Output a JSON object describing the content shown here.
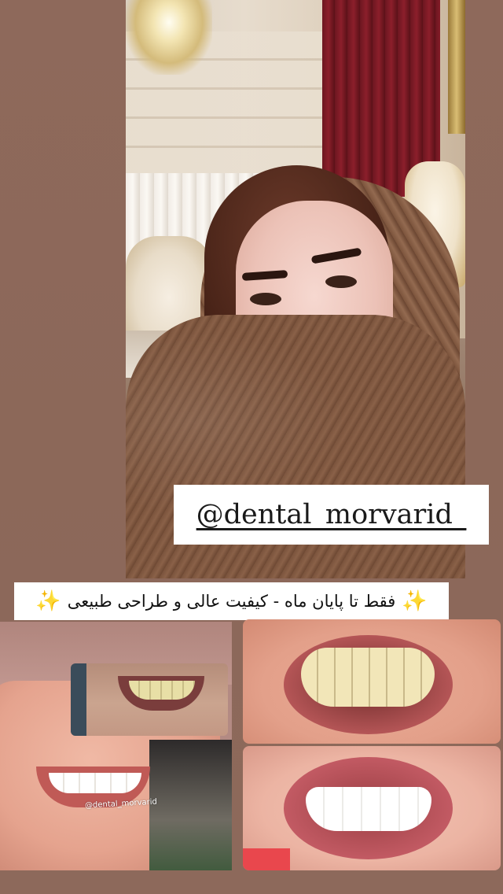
{
  "story": {
    "username_sticker": "@dental_morvarid_",
    "caption": {
      "text": "فقط تا پایان ماه - کیفیت عالی و طراحی طبیعی",
      "sparkle_left": "✨",
      "sparkle_right": "✨"
    },
    "collage": {
      "watermark": "@dental_morvarid"
    }
  },
  "colors": {
    "background": "#8f6a5c",
    "sticker_bg": "#ffffff",
    "text": "#1a1a1a",
    "sparkle": "#f2b825"
  }
}
